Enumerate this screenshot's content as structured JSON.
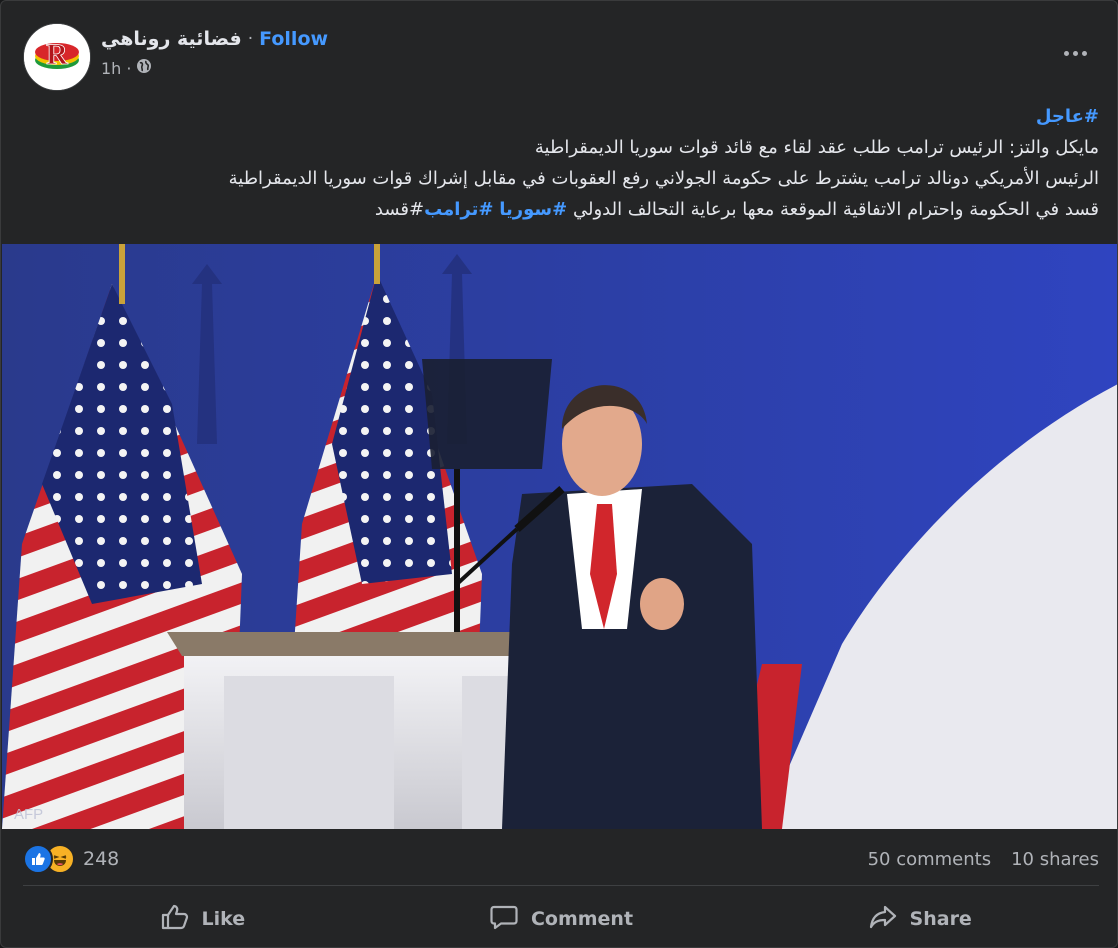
{
  "post": {
    "page_name": "فضائية روناهي",
    "separator": "·",
    "follow_label": "Follow",
    "time": "1h",
    "audience_icon": "globe-icon",
    "more_icon": "more-options-icon",
    "text": {
      "tag_urgent": "#عاجل",
      "line1": "مايكل والتز: الرئيس ترامب طلب عقد لقاء مع قائد قوات سوريا الديمقراطية",
      "line2": "الرئيس الأمريكي دونالد ترامب يشترط على حكومة الجولاني رفع العقوبات في مقابل إشراك قوات سوريا الديمقراطية",
      "line3_text": "قسد في الحكومة واحترام الاتفاقية الموقعة معها برعاية التحالف الدولي",
      "tag_syria": "#سوريا",
      "tag_trump": "#ترامب",
      "tag_qasad": "#قسد"
    },
    "photo": {
      "watermark": "AFP",
      "description_icon": "news-photo"
    },
    "reactions": {
      "icons": [
        "like-icon",
        "haha-icon"
      ],
      "count": "248"
    },
    "comments_label": "50 comments",
    "shares_label": "10 shares",
    "actions": {
      "like": "Like",
      "comment": "Comment",
      "share": "Share"
    },
    "colors": {
      "background": "#242526",
      "link": "#4599ff",
      "muted": "#b0b3b8",
      "like_blue": "#1b74e4",
      "haha_yellow": "#f7b125"
    }
  }
}
